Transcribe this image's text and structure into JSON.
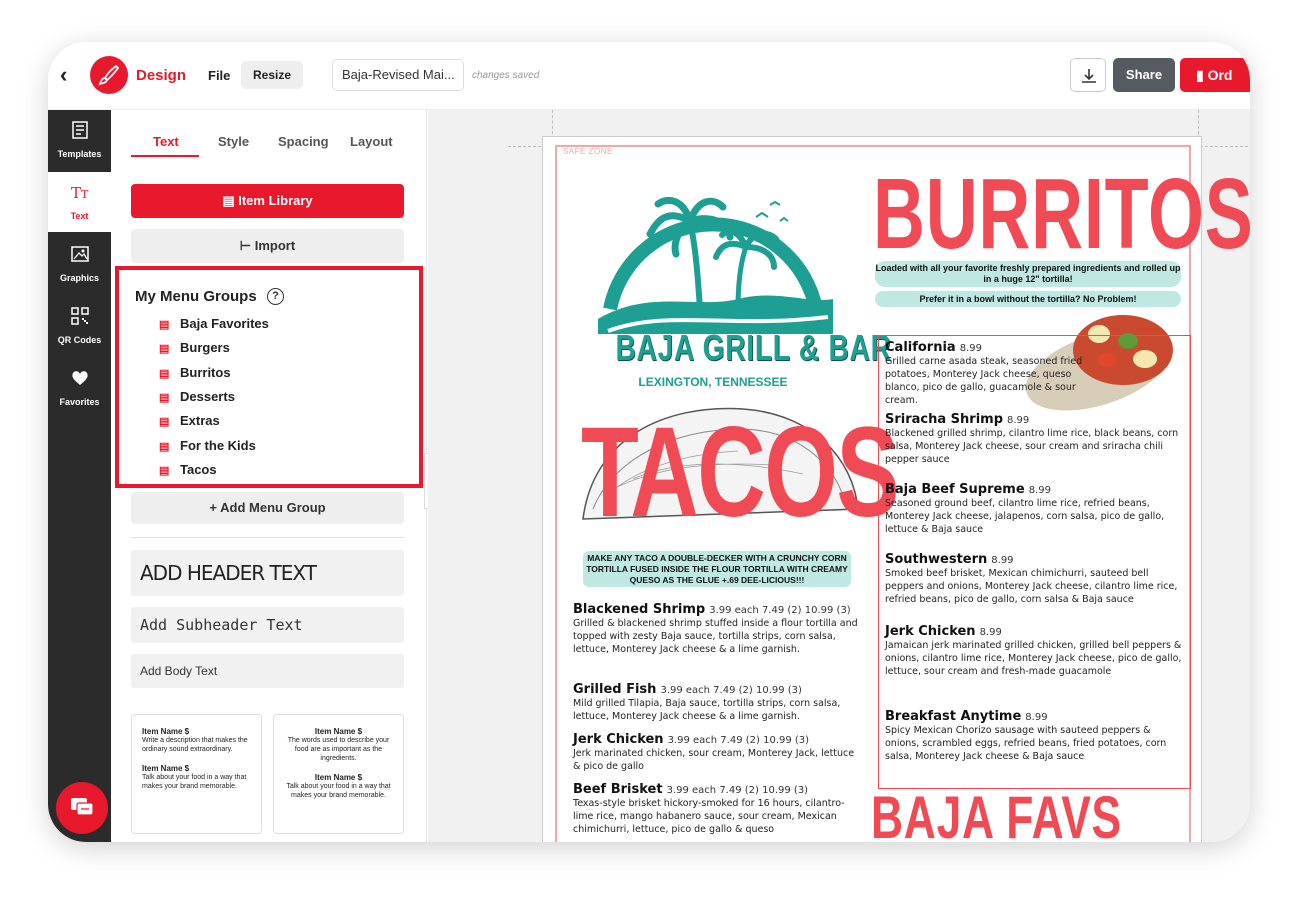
{
  "header": {
    "back_icon": "chevron-left-icon",
    "logo_icon": "brush-icon",
    "design_label": "Design",
    "file_label": "File",
    "resize_label": "Resize",
    "doc_name": "Baja-Revised Mai...",
    "save_status": "changes saved",
    "download_icon": "download-icon",
    "share_label": "Share",
    "order_label": "Ord"
  },
  "rail": [
    {
      "label": "Templates",
      "icon": "template-icon"
    },
    {
      "label": "Text",
      "icon": "text-icon"
    },
    {
      "label": "Graphics",
      "icon": "image-icon"
    },
    {
      "label": "QR Codes",
      "icon": "qr-icon"
    },
    {
      "label": "Favorites",
      "icon": "heart-icon"
    }
  ],
  "panel": {
    "tabs": [
      "Text",
      "Style",
      "Spacing",
      "Layout"
    ],
    "item_library_label": "Item Library",
    "import_label": "Import",
    "groups_title": "My Menu Groups",
    "help_symbol": "?",
    "groups": [
      "Baja Favorites",
      "Burgers",
      "Burritos",
      "Desserts",
      "Extras",
      "For the Kids",
      "Tacos"
    ],
    "add_group_label": "+ Add Menu Group",
    "header_text": "ADD HEADER TEXT",
    "subheader_text": "Add Subheader Text",
    "body_text": "Add Body Text",
    "template_cards": [
      [
        {
          "title": "Item Name $",
          "desc": "Write a description that makes the ordinary sound extraordinary."
        },
        {
          "title": "Item Name $",
          "desc": "Talk about your food in a way that makes your brand memorable."
        }
      ],
      [
        {
          "title": "Item Name $",
          "desc": "The words used to describe your food are as important as the ingredients."
        },
        {
          "title": "Item Name $",
          "desc": "Talk about your food in a way that makes your brand memorable."
        }
      ]
    ]
  },
  "canvas": {
    "safe_zone_label": "SAFE ZONE",
    "brand_name": "BAJA GRILL & BAR",
    "location": "LEXINGTON, TENNESSEE",
    "tacos_heading": "TACOS",
    "tacos_note": "MAKE ANY TACO A DOUBLE-DECKER WITH A CRUNCHY CORN TORTILLA FUSED INSIDE THE FLOUR TORTILLA WITH CREAMY QUESO AS THE GLUE +.69 DEE-LICIOUS!!!",
    "taco_items": [
      {
        "name": "Blackened Shrimp",
        "price": "3.99 each 7.49 (2) 10.99 (3)",
        "desc": "Grilled & blackened shrimp stuffed inside a flour tortilla and topped with zesty Baja sauce, tortilla strips, corn salsa, lettuce, Monterey Jack cheese & a lime garnish."
      },
      {
        "name": "Grilled Fish",
        "price": "3.99 each 7.49 (2) 10.99 (3)",
        "desc": "Mild grilled Tilapia, Baja sauce, tortilla strips, corn salsa, lettuce, Monterey Jack cheese & a lime garnish."
      },
      {
        "name": "Jerk Chicken",
        "price": "3.99 each 7.49 (2) 10.99 (3)",
        "desc": "Jerk marinated chicken, sour cream, Monterey Jack, lettuce & pico de gallo"
      },
      {
        "name": "Beef Brisket",
        "price": "3.99 each 7.49 (2) 10.99 (3)",
        "desc": "Texas-style brisket hickory-smoked for 16 hours, cilantro-lime rice, mango habanero sauce, sour cream, Mexican chimichurri, lettuce, pico de gallo & queso"
      }
    ],
    "burritos_heading": "BURRITOS",
    "burritos_note1": "Loaded with all your favorite freshly prepared ingredients and rolled up in a huge 12\" tortilla!",
    "burritos_note2": "Prefer it in a bowl without the tortilla? No Problem!",
    "burrito_items": [
      {
        "name": "California",
        "price": "8.99",
        "desc": "Grilled carne asada steak, seasoned fried potatoes, Monterey Jack cheese, queso blanco, pico de gallo, guacamole & sour cream."
      },
      {
        "name": "Sriracha Shrimp",
        "price": "8.99",
        "desc": "Blackened grilled shrimp, cilantro lime rice, black beans, corn salsa, Monterey Jack cheese, sour cream and sriracha chili pepper sauce"
      },
      {
        "name": "Baja Beef Supreme",
        "price": "8.99",
        "desc": "Seasoned ground beef, cilantro lime rice, refried beans, Monterey Jack cheese, jalapenos, corn salsa, pico de gallo, lettuce & Baja sauce"
      },
      {
        "name": "Southwestern",
        "price": "8.99",
        "desc": "Smoked beef brisket, Mexican chimichurri, sauteed bell peppers and onions, Monterey Jack cheese, cilantro lime rice, refried beans, pico de gallo, corn salsa & Baja sauce"
      },
      {
        "name": "Jerk Chicken",
        "price": "8.99",
        "desc": "Jamaican jerk marinated grilled chicken, grilled bell peppers & onions, cilantro lime rice, Monterey Jack cheese, pico de gallo, lettuce, sour cream and fresh-made guacamole"
      },
      {
        "name": "Breakfast Anytime",
        "price": "8.99",
        "desc": "Spicy Mexican Chorizo sausage with sauteed peppers & onions, scrambled eggs, refried beans, fried potatoes, corn salsa, Monterey Jack cheese & Baja sauce"
      }
    ],
    "baja_favs_heading": "BAJA FAVS"
  },
  "colors": {
    "accent": "#e8192c",
    "teal": "#1d9f93",
    "menu_red": "#f04a55",
    "rail_bg": "#2b2b2b"
  },
  "chat_icon": "chat-icon"
}
